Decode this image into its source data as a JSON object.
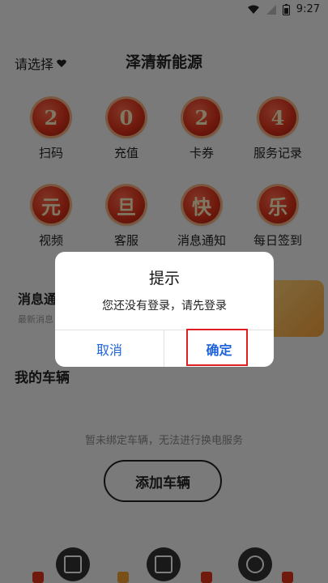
{
  "status_bar": {
    "time": "9:27"
  },
  "header": {
    "region_select": "请选择",
    "title": "泽清新能源"
  },
  "grid": [
    {
      "char": "2",
      "label": "扫码"
    },
    {
      "char": "0",
      "label": "充值"
    },
    {
      "char": "2",
      "label": "卡券"
    },
    {
      "char": "4",
      "label": "服务记录"
    },
    {
      "char": "元",
      "label": "视频"
    },
    {
      "char": "旦",
      "label": "客服"
    },
    {
      "char": "快",
      "label": "消息通知"
    },
    {
      "char": "乐",
      "label": "每日签到"
    }
  ],
  "notice": {
    "title": "消息通",
    "subtitle": "最新消息"
  },
  "vehicles": {
    "title": "我的车辆",
    "empty_text": "暂未绑定车辆，无法进行换电服务",
    "add_button": "添加车辆"
  },
  "dialog": {
    "title": "提示",
    "message": "您还没有登录，请先登录",
    "cancel": "取消",
    "confirm": "确定"
  },
  "colors": {
    "accent_blue": "#1f64d8",
    "highlight_red": "#e02020"
  }
}
